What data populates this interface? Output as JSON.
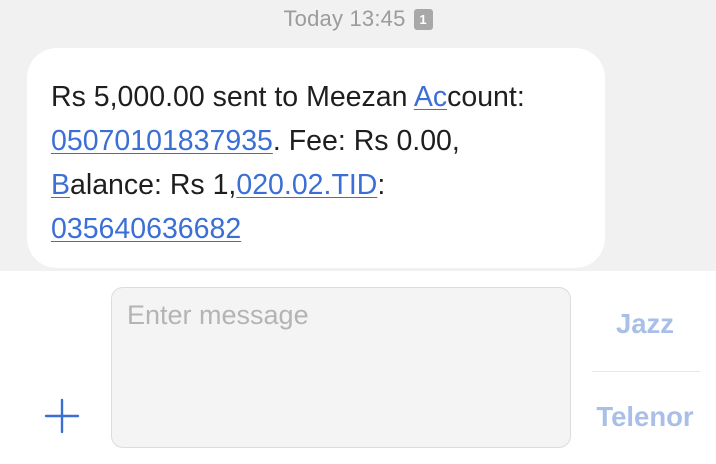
{
  "thread": {
    "timestamp": "Today 13:45",
    "sim_badge": "1"
  },
  "message": {
    "line1_text": "Rs 5,000.00 sent to Meezan ",
    "line1_link": "Ac",
    "line1_rest": "count:",
    "line2_link": "05070101837935",
    "line2_rest": ". Fee: Rs 0.00,",
    "line3_link": "B",
    "line3_text": "alance: Rs 1,",
    "line3_link2": "020.02.TID",
    "line3_rest": ":",
    "line4_link": "035640636682"
  },
  "composer": {
    "placeholder": "Enter message",
    "value": "",
    "sim1_label": "Jazz",
    "sim2_label": "Telenor"
  },
  "colors": {
    "link": "#3b6fd6",
    "sim_label": "#aabfe8",
    "plus_icon": "#3b6fd6",
    "thread_bg": "#f1f1f1"
  },
  "icons": {
    "add": "plus-icon"
  }
}
